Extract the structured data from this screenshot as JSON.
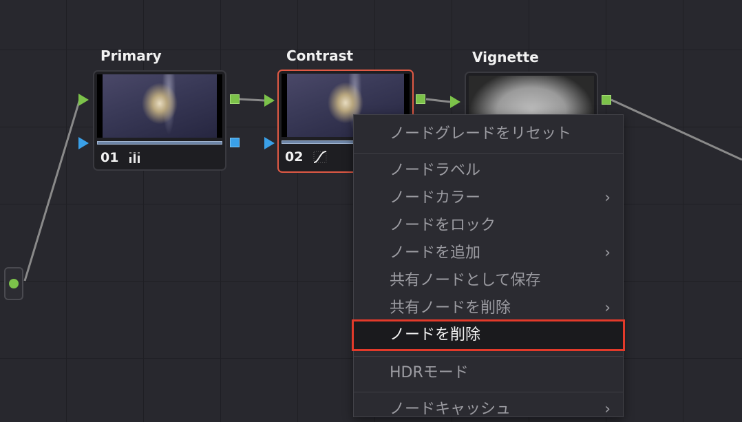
{
  "nodes": [
    {
      "title": "Primary",
      "number": "01",
      "tool_icon": "bars-icon"
    },
    {
      "title": "Contrast",
      "number": "02",
      "tool_icon": "curve-icon"
    },
    {
      "title": "Vignette"
    }
  ],
  "context_menu": {
    "items": [
      {
        "label": "ノードグレードをリセット"
      },
      {
        "label": "ノードラベル"
      },
      {
        "label": "ノードカラー",
        "has_submenu": true
      },
      {
        "label": "ノードをロック"
      },
      {
        "label": "ノードを追加",
        "has_submenu": true
      },
      {
        "label": "共有ノードとして保存"
      },
      {
        "label": "共有ノードを削除",
        "has_submenu": true
      },
      {
        "label": "ノードを削除",
        "highlighted": true
      },
      {
        "label": "HDRモード"
      },
      {
        "label": "ノードキャッシュ",
        "has_submenu": true
      }
    ],
    "submenu_glyph": "›"
  },
  "colors": {
    "highlight_border": "#e33a2a",
    "selected_node_border": "#e25a45",
    "rgb_port": "#7cc24a",
    "key_port": "#3aa0e8"
  }
}
